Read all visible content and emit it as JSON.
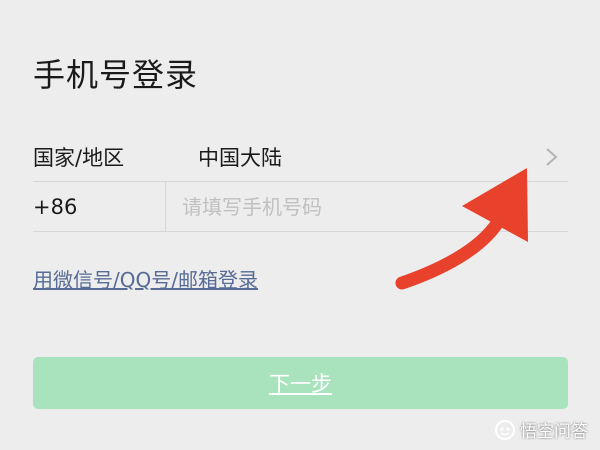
{
  "page": {
    "title": "手机号登录"
  },
  "country_row": {
    "label": "国家/地区",
    "value": "中国大陆",
    "chevron_icon": "chevron-right-icon"
  },
  "phone_row": {
    "country_code": "+86",
    "placeholder": "请填写手机号码",
    "value": ""
  },
  "alt_login_link": "用微信号/QQ号/邮箱登录",
  "next_button": {
    "label": "下一步",
    "color": "#a9e3be"
  },
  "annotation": {
    "type": "arrow",
    "color": "#e8412c"
  },
  "watermark": {
    "text": "悟空问答",
    "icon": "wukong-logo-icon"
  }
}
